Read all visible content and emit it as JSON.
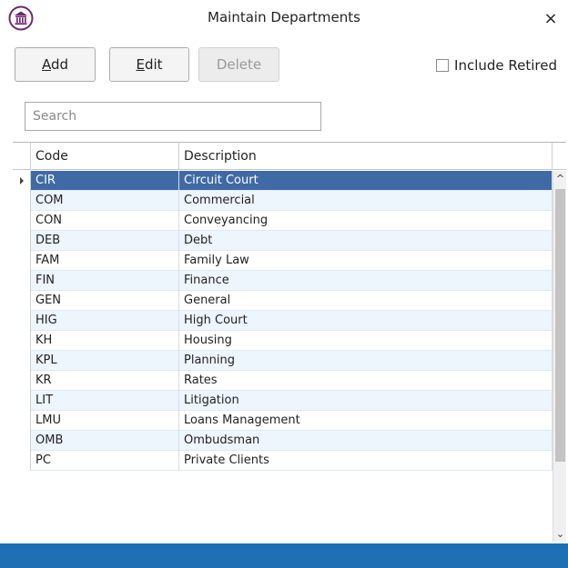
{
  "window": {
    "title": "Maintain Departments",
    "close_glyph": "×",
    "app_icon": "institution-icon"
  },
  "toolbar": {
    "add": {
      "first": "A",
      "rest": "dd"
    },
    "edit": {
      "first": "E",
      "rest": "dit"
    },
    "delete": {
      "label": "Delete",
      "disabled": true
    },
    "include_retired_label": "Include Retired",
    "include_retired_checked": false
  },
  "search": {
    "placeholder": "Search",
    "value": ""
  },
  "grid": {
    "columns": {
      "code": "Code",
      "description": "Description"
    },
    "rows": [
      {
        "code": "CIR",
        "description": "Circuit Court",
        "selected": true
      },
      {
        "code": "COM",
        "description": "Commercial"
      },
      {
        "code": "CON",
        "description": "Conveyancing"
      },
      {
        "code": "DEB",
        "description": "Debt"
      },
      {
        "code": "FAM",
        "description": "Family Law"
      },
      {
        "code": "FIN",
        "description": "Finance"
      },
      {
        "code": "GEN",
        "description": "General"
      },
      {
        "code": "HIG",
        "description": "High Court"
      },
      {
        "code": "KH",
        "description": "Housing"
      },
      {
        "code": "KPL",
        "description": "Planning"
      },
      {
        "code": "KR",
        "description": "Rates"
      },
      {
        "code": "LIT",
        "description": "Litigation"
      },
      {
        "code": "LMU",
        "description": "Loans Management"
      },
      {
        "code": "OMB",
        "description": "Ombudsman"
      },
      {
        "code": "PC",
        "description": "Private Clients"
      }
    ]
  },
  "colors": {
    "selected_row": "#3f6aa6",
    "alt_row": "#edf5fd",
    "status_bar": "#1f6fb5",
    "icon_purple": "#6b2a6b"
  }
}
